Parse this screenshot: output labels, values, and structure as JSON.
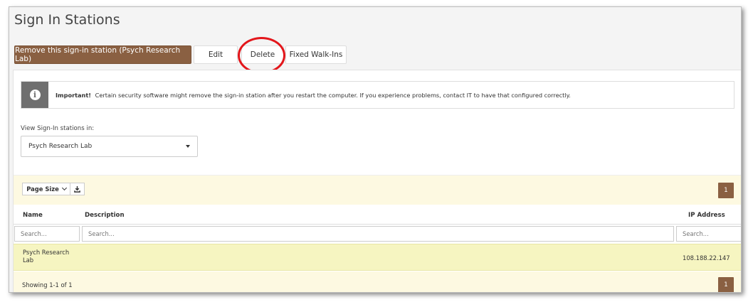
{
  "page": {
    "title": "Sign In Stations"
  },
  "toolbar": {
    "remove_label": "Remove this sign-in station (Psych Research Lab)",
    "edit_label": "Edit",
    "delete_label": "Delete",
    "walkins_label": "Fixed Walk-Ins"
  },
  "alert": {
    "icon": "info-icon",
    "strong": "Important!",
    "text": "Certain security software might remove the sign-in station after you restart the computer. If you experience problems, contact IT to have that configured correctly."
  },
  "view": {
    "label": "View Sign-In stations in:",
    "selected": "Psych Research Lab"
  },
  "grid": {
    "page_size_label": "Page Size",
    "download_icon": "download-icon",
    "current_page": "1",
    "columns": {
      "name": "Name",
      "description": "Description",
      "ip": "IP Address"
    },
    "filters": {
      "name_placeholder": "Search...",
      "description_placeholder": "Search...",
      "ip_placeholder": "Search..."
    },
    "rows": [
      {
        "name": "Psych Research Lab",
        "description": "",
        "ip": "108.188.22.147"
      }
    ],
    "showing": "Showing 1-1 of 1"
  },
  "colors": {
    "brand": "#8a6042",
    "highlight": "#e3161b",
    "row_highlight": "#f6f5c1",
    "toolbar_bg": "#fdf9e1"
  }
}
